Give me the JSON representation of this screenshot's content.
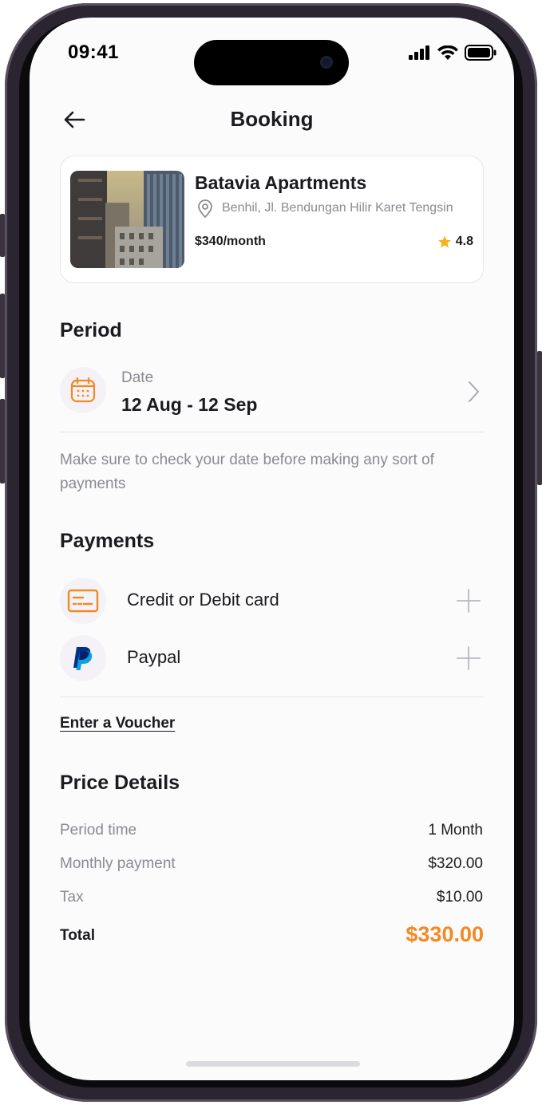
{
  "status": {
    "time": "09:41"
  },
  "header": {
    "title": "Booking"
  },
  "property": {
    "name": "Batavia Apartments",
    "address": "Benhil, Jl. Bendungan Hilir Karet Tengsin",
    "price": "$340/month",
    "rating": "4.8"
  },
  "period": {
    "section_title": "Period",
    "date_label": "Date",
    "date_value": "12 Aug - 12 Sep",
    "note": "Make sure to check your date before making any sort of payments"
  },
  "payments": {
    "section_title": "Payments",
    "methods": [
      {
        "label": "Credit or Debit card",
        "icon": "credit-card-icon"
      },
      {
        "label": "Paypal",
        "icon": "paypal-icon"
      }
    ],
    "voucher_link": "Enter a Voucher"
  },
  "price_details": {
    "section_title": "Price Details",
    "rows": [
      {
        "label": "Period time",
        "value": "1 Month"
      },
      {
        "label": "Monthly payment",
        "value": "$320.00"
      },
      {
        "label": "Tax",
        "value": "$10.00"
      }
    ],
    "total_label": "Total",
    "total_value": "$330.00"
  },
  "colors": {
    "accent": "#f08a24",
    "text": "#1b1b1f",
    "muted": "#8a8a92",
    "star": "#f5b21b",
    "paypal_dark": "#003087",
    "paypal_light": "#009cde"
  }
}
